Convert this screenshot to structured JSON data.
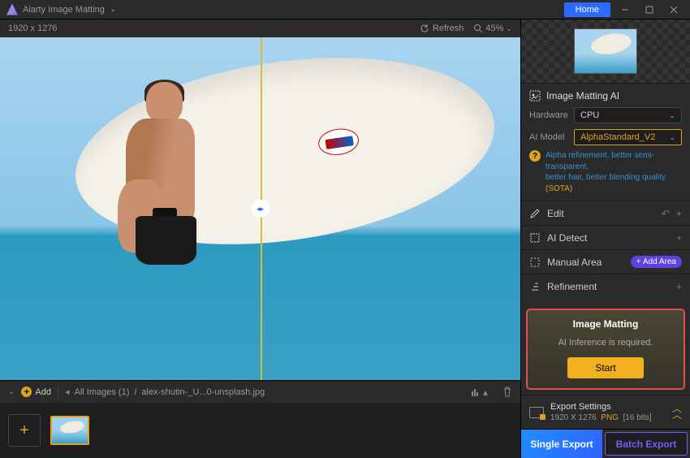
{
  "titlebar": {
    "title": "Aiarty Image Matting",
    "home": "Home"
  },
  "viewer": {
    "dimensions": "1920 x 1276",
    "refresh": "Refresh",
    "zoom": "45%"
  },
  "toolbar": {
    "add": "Add",
    "all_images": "All Images (1)",
    "filename": "alex-shutin-_U...0-unsplash.jpg"
  },
  "panels": {
    "matting_ai": {
      "title": "Image Matting AI",
      "hardware_label": "Hardware",
      "hardware_value": "CPU",
      "model_label": "AI Model",
      "model_value": "AlphaStandard_V2",
      "desc1": "Alpha refinement, better semi-transparent,",
      "desc2": "better hair, better blending quality.",
      "sota": " (SOTA)"
    },
    "edit": "Edit",
    "ai_detect": "AI Detect",
    "manual_area": "Manual Area",
    "add_area": "+ Add Area",
    "refinement": "Refinement"
  },
  "matting_box": {
    "title": "Image Matting",
    "msg": "AI Inference is required.",
    "start": "Start"
  },
  "export": {
    "title": "Export Settings",
    "dims": "1920 X 1276",
    "fmt": "PNG",
    "bits": "[16 bits]",
    "single": "Single Export",
    "batch": "Batch Export"
  }
}
